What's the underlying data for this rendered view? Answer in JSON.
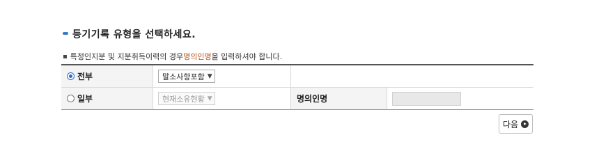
{
  "heading": {
    "title": "등기기록 유형을 선택하세요."
  },
  "notice": {
    "bullet": "▪",
    "before": "특정인지분 및 지분취득이력의 경우 ",
    "highlight": "명의인명",
    "after": "을 입력하셔야 합니다."
  },
  "form": {
    "rows": [
      {
        "label": "전부",
        "selected": true,
        "select_value": "말소사항포함",
        "select_disabled": false
      },
      {
        "label": "일부",
        "selected": false,
        "select_value": "현재소유현황",
        "select_disabled": true,
        "field_label": "명의인명",
        "field_value": ""
      }
    ]
  },
  "actions": {
    "next_label": "다음"
  },
  "colors": {
    "accent": "#3d7bc4",
    "highlight": "#b5541c",
    "radio_checked": "#2a6fc9"
  }
}
